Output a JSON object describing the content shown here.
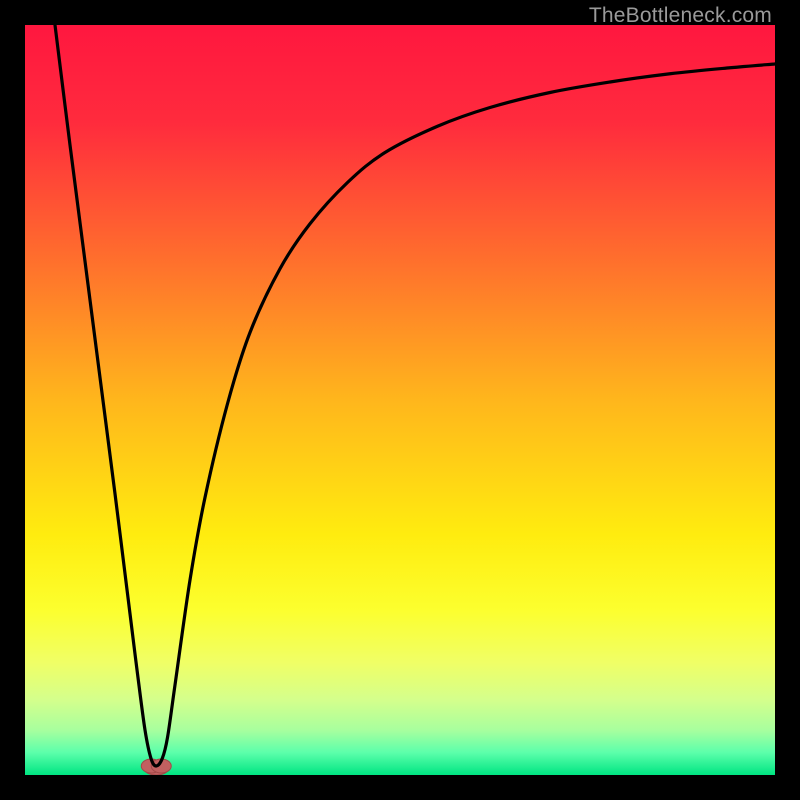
{
  "watermark": "TheBottleneck.com",
  "chart_data": {
    "type": "line",
    "title": "",
    "xlabel": "",
    "ylabel": "",
    "xlim": [
      0,
      100
    ],
    "ylim": [
      0,
      100
    ],
    "gradient_stops": [
      {
        "offset": 0.0,
        "color": "#ff173f"
      },
      {
        "offset": 0.13,
        "color": "#ff2b3d"
      },
      {
        "offset": 0.3,
        "color": "#ff6a2e"
      },
      {
        "offset": 0.5,
        "color": "#ffb61c"
      },
      {
        "offset": 0.68,
        "color": "#ffec0f"
      },
      {
        "offset": 0.78,
        "color": "#fcff2e"
      },
      {
        "offset": 0.85,
        "color": "#f0ff66"
      },
      {
        "offset": 0.9,
        "color": "#d4ff8c"
      },
      {
        "offset": 0.94,
        "color": "#a8ff9e"
      },
      {
        "offset": 0.97,
        "color": "#5cffab"
      },
      {
        "offset": 1.0,
        "color": "#00e582"
      }
    ],
    "series": [
      {
        "name": "bottleneck-curve",
        "x": [
          4.0,
          6.0,
          8.0,
          10.0,
          12.0,
          14.0,
          15.0,
          16.0,
          16.8,
          17.5,
          18.3,
          19.0,
          20.0,
          22.0,
          24.0,
          27.0,
          30.0,
          34.0,
          38.0,
          43.0,
          48.0,
          55.0,
          62.0,
          70.0,
          78.0,
          86.0,
          94.0,
          100.0
        ],
        "y": [
          100.0,
          84.0,
          68.5,
          53.0,
          37.5,
          21.5,
          13.5,
          6.0,
          2.2,
          1.2,
          2.2,
          5.0,
          12.0,
          26.0,
          37.0,
          49.5,
          59.0,
          67.5,
          73.5,
          79.0,
          83.0,
          86.5,
          89.0,
          91.0,
          92.4,
          93.5,
          94.3,
          94.8
        ]
      }
    ],
    "marker": {
      "x": 17.5,
      "y": 1.2,
      "fill": "#c16060",
      "stroke": "#a24848",
      "rx": 10,
      "ry": 7
    }
  }
}
